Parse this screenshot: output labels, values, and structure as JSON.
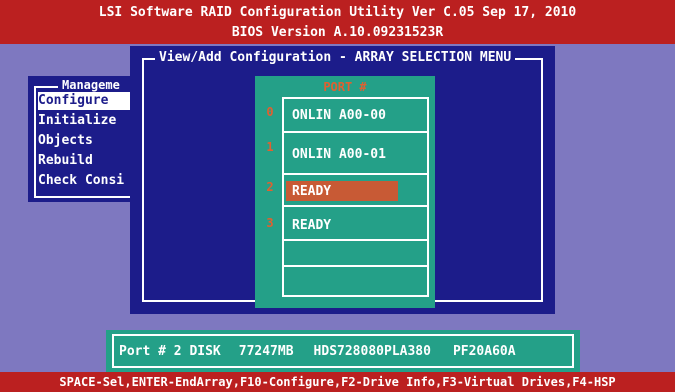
{
  "title": {
    "line1": "LSI Software RAID Configuration Utility Ver C.05 Sep 17, 2010",
    "line2": "BIOS Version   A.10.09231523R"
  },
  "main_dialog": {
    "title": "View/Add Configuration - ARRAY SELECTION MENU"
  },
  "management_menu": {
    "title": "Manageme",
    "items": [
      {
        "label": "Configure",
        "selected": true
      },
      {
        "label": "Initialize",
        "selected": false
      },
      {
        "label": "Objects",
        "selected": false
      },
      {
        "label": "Rebuild",
        "selected": false
      },
      {
        "label": "Check Consi",
        "selected": false
      }
    ]
  },
  "port_table": {
    "header": "PORT #",
    "rows": [
      {
        "port": "0",
        "status": "ONLIN A00-00",
        "selected": false
      },
      {
        "port": "1",
        "status": "ONLIN A00-01",
        "selected": false
      },
      {
        "port": "2",
        "status": "READY",
        "selected": true
      },
      {
        "port": "3",
        "status": "READY",
        "selected": false
      },
      {
        "port": "",
        "status": "",
        "selected": false
      },
      {
        "port": "",
        "status": "",
        "selected": false
      }
    ]
  },
  "info_bar": {
    "port": "Port # 2 DISK",
    "size": "77247MB",
    "model": "HDS728080PLA380",
    "firmware": "PF20A60A"
  },
  "footer": {
    "text": "SPACE-Sel,ENTER-EndArray,F10-Configure,F2-Drive Info,F3-Virtual Drives,F4-HSP"
  },
  "colors": {
    "background": "#7e78c0",
    "title_bar": "#bb2020",
    "dialog": "#1c1c8a",
    "teal_panel": "#24a088",
    "selection": "#c85a35"
  }
}
